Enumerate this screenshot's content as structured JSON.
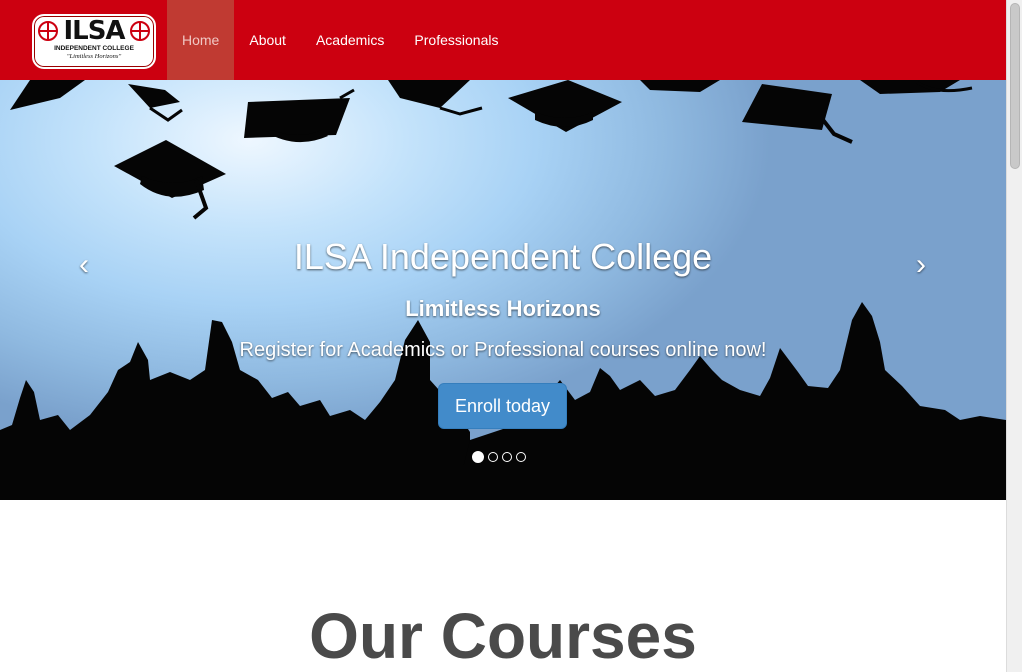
{
  "brand": {
    "logo_text": "ILSA",
    "logo_subtitle": "INDEPENDENT COLLEGE",
    "logo_tagline": "\"Limitless Horizons\""
  },
  "nav": {
    "items": [
      {
        "label": "Home",
        "active": true
      },
      {
        "label": "About",
        "active": false
      },
      {
        "label": "Academics",
        "active": false
      },
      {
        "label": "Professionals",
        "active": false
      }
    ]
  },
  "carousel": {
    "title": "ILSA Independent College",
    "subtitle": "Limitless Horizons",
    "description": "Register for Academics or Professional courses online now!",
    "cta_label": "Enroll today",
    "prev_icon": "‹",
    "next_icon": "›",
    "slide_count": 4,
    "active_slide": 1
  },
  "section": {
    "title": "Our Courses"
  },
  "colors": {
    "navbar": "#cc0010",
    "nav_active": "#c03a32",
    "primary_button": "#428bca",
    "heading": "#4a4a4a"
  }
}
